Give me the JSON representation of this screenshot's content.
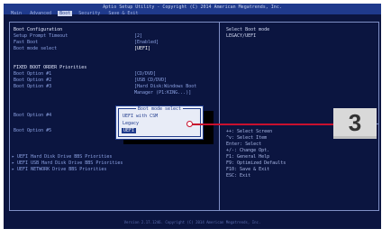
{
  "bios": {
    "title": "Aptio Setup Utility - Copyright (C) 2014 American Megatrends, Inc.",
    "tabs": [
      "Main",
      "Advanced",
      "Boot",
      "Security",
      "Save & Exit"
    ],
    "active_tab": "Boot",
    "settings": [
      {
        "label": "Boot Configuration",
        "value": ""
      },
      {
        "label": "Setup Prompt Timeout",
        "value": "[2]"
      },
      {
        "label": "Fast Boot",
        "value": "[Enabled]"
      },
      {
        "label": "Boot mode select",
        "value": "[UEFI]"
      },
      {
        "label": "",
        "value": ""
      },
      {
        "label": "FIXED BOOT ORDER Priorities",
        "value": ""
      },
      {
        "label": "Boot Option #1",
        "value": "[CD/DVD]"
      },
      {
        "label": "Boot Option #2",
        "value": "[USB CD/DVD]"
      },
      {
        "label": "Boot Option #3",
        "value": "[Hard Disk:Windows Boot"
      },
      {
        "label": "",
        "value": "Manager (P1:KING...)]"
      },
      {
        "label": "Boot Option #4",
        "value": ""
      },
      {
        "label": "",
        "value": ""
      },
      {
        "label": "Boot Option #5",
        "value": ""
      }
    ],
    "bbs": [
      "UEFI Hard Disk Drive BBS Priorities",
      "UEFI USB Hard Disk Drive BBS Priorities",
      "UEFI NETWORK Drive BBS Priorities"
    ],
    "help_text": [
      "Select Boot mode",
      "LEGACY/UEFI"
    ],
    "keys": [
      "++: Select Screen",
      "^v: Select Item",
      "Enter: Select",
      "+/-: Change Opt.",
      "F1: General Help",
      "F9: Optimized Defaults",
      "F10: Save & Exit",
      "ESC: Exit"
    ],
    "footer": "Version 2.17.1246. Copyright (C) 2014 American Megatrends, Inc."
  },
  "popup": {
    "title": "Boot mode select",
    "options": [
      "UEFI with CSM",
      "Legacy",
      "UEFI"
    ],
    "selected": "UEFI"
  },
  "callout": {
    "number": "3",
    "line_color": "#c8102e"
  },
  "colors": {
    "bios_bg": "#0b1540",
    "bios_header": "#1f3a8c",
    "popup_bg": "#e8ecf7"
  }
}
